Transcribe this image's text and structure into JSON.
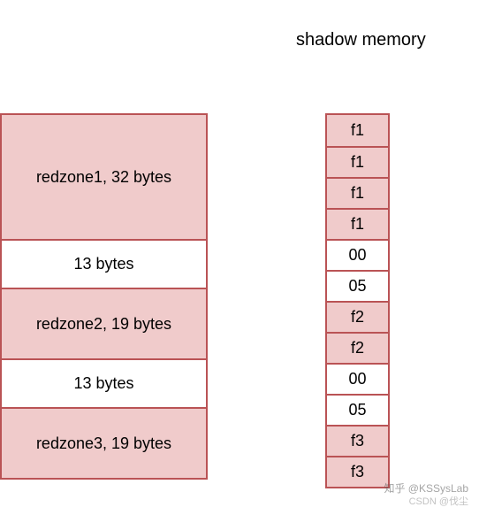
{
  "title": "shadow memory",
  "memory_blocks": [
    {
      "label": "redzone1, 32 bytes",
      "kind": "redzone",
      "hclass": "h1"
    },
    {
      "label": "13 bytes",
      "kind": "normal",
      "hclass": "h2"
    },
    {
      "label": "redzone2, 19 bytes",
      "kind": "redzone",
      "hclass": "h3"
    },
    {
      "label": "13 bytes",
      "kind": "normal",
      "hclass": "h4"
    },
    {
      "label": "redzone3, 19 bytes",
      "kind": "redzone",
      "hclass": "h5"
    }
  ],
  "shadow_cells": [
    {
      "val": "f1",
      "kind": "s-red"
    },
    {
      "val": "f1",
      "kind": "s-red"
    },
    {
      "val": "f1",
      "kind": "s-red"
    },
    {
      "val": "f1",
      "kind": "s-red"
    },
    {
      "val": "00",
      "kind": "s-white"
    },
    {
      "val": "05",
      "kind": "s-white"
    },
    {
      "val": "f2",
      "kind": "s-red"
    },
    {
      "val": "f2",
      "kind": "s-red"
    },
    {
      "val": "00",
      "kind": "s-white"
    },
    {
      "val": "05",
      "kind": "s-white"
    },
    {
      "val": "f3",
      "kind": "s-red"
    },
    {
      "val": "f3",
      "kind": "s-red"
    }
  ],
  "watermark1": "知乎 @KSSysLab",
  "watermark2": "CSDN @伐尘",
  "chart_data": {
    "type": "table",
    "title": "shadow memory",
    "memory_layout": [
      {
        "region": "redzone1",
        "size_bytes": 32
      },
      {
        "region": "data",
        "size_bytes": 13
      },
      {
        "region": "redzone2",
        "size_bytes": 19
      },
      {
        "region": "data",
        "size_bytes": 13
      },
      {
        "region": "redzone3",
        "size_bytes": 19
      }
    ],
    "shadow_memory_bytes": [
      "f1",
      "f1",
      "f1",
      "f1",
      "00",
      "05",
      "f2",
      "f2",
      "00",
      "05",
      "f3",
      "f3"
    ]
  }
}
